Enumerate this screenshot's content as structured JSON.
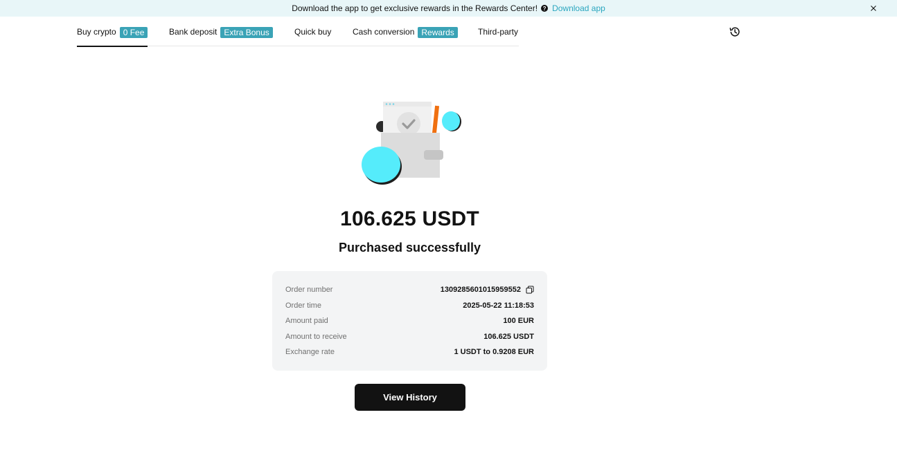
{
  "banner": {
    "text": "Download the app to get exclusive rewards in the Rewards Center!",
    "link": "Download app"
  },
  "tabs": [
    {
      "label": "Buy crypto",
      "badge": "0 Fee",
      "active": true
    },
    {
      "label": "Bank deposit",
      "badge": "Extra Bonus",
      "active": false
    },
    {
      "label": "Quick buy",
      "badge": "",
      "active": false
    },
    {
      "label": "Cash conversion",
      "badge": "Rewards",
      "active": false
    },
    {
      "label": "Third-party",
      "badge": "",
      "active": false
    }
  ],
  "result": {
    "amount": "106.625 USDT",
    "status": "Purchased successfully"
  },
  "details": [
    {
      "label": "Order number",
      "value": "1309285601015959552"
    },
    {
      "label": "Order time",
      "value": "2025-05-22 11:18:53"
    },
    {
      "label": "Amount paid",
      "value": "100 EUR"
    },
    {
      "label": "Amount to receive",
      "value": "106.625 USDT"
    },
    {
      "label": "Exchange rate",
      "value": "1 USDT to 0.9208 EUR"
    }
  ],
  "button": {
    "label": "View History"
  },
  "colors": {
    "banner_bg": "#e8f6f8",
    "accent": "#2aa6bf",
    "badge_bg": "#3aa3b6",
    "card_bg": "#f3f4f5",
    "button_bg": "#121212"
  },
  "icons": [
    "help-icon",
    "close-icon",
    "history-icon",
    "copy-icon",
    "wallet-success-illustration"
  ]
}
